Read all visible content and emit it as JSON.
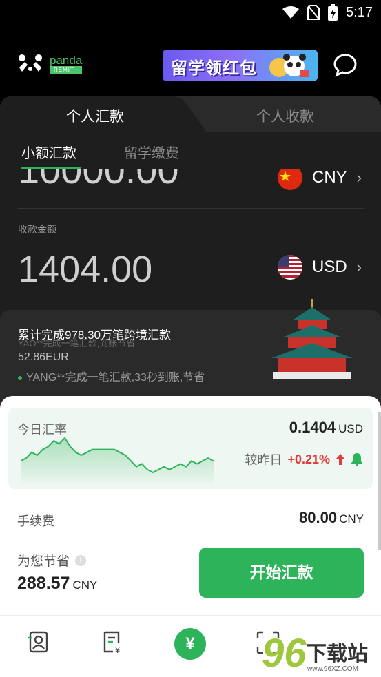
{
  "status_bar": {
    "time": "5:17",
    "icons": [
      "wifi-icon",
      "no-sim-icon",
      "battery-charging-icon"
    ]
  },
  "header": {
    "logo_name": "panda",
    "logo_sub": "REMIT",
    "banner_text": "留学领红包",
    "chat_icon": "chat-bubble-icon"
  },
  "tabs": [
    {
      "label": "个人汇款",
      "active": true
    },
    {
      "label": "个人收款",
      "active": false
    }
  ],
  "subtabs": [
    {
      "label": "小额汇款",
      "active": true
    },
    {
      "label": "留学缴费",
      "active": false
    }
  ],
  "send": {
    "amount": "10000.00",
    "currency": "CNY",
    "flag": "china-flag-icon"
  },
  "receive": {
    "label": "收款金额",
    "amount": "1404.00",
    "currency": "USD",
    "flag": "usa-flag-icon"
  },
  "ticker": {
    "title": "累计完成978.30万笔跨境汇款",
    "line0": "YAO**完成一笔汇款,到账节省",
    "line1": "52.86EUR",
    "line2": "YANG**完成一笔汇款,33秒到账,节省"
  },
  "rate": {
    "label": "今日汇率",
    "value": "0.1404",
    "unit": "USD",
    "change_label": "较昨日",
    "change_value": "+0.21%",
    "series": [
      0.1398,
      0.1399,
      0.1401,
      0.14,
      0.1402,
      0.1403,
      0.1405,
      0.1404,
      0.1406,
      0.1403,
      0.1401,
      0.14,
      0.1401,
      0.1402,
      0.1402,
      0.1402,
      0.1402,
      0.1402,
      0.1401,
      0.14,
      0.1398,
      0.1396,
      0.1397,
      0.1395,
      0.1394,
      0.1395,
      0.1396,
      0.1395,
      0.1396,
      0.1397,
      0.1396,
      0.1398,
      0.1397,
      0.1398,
      0.1399,
      0.1398
    ]
  },
  "fee": {
    "label": "手续费",
    "value": "80.00",
    "unit": "CNY"
  },
  "savings": {
    "label": "为您节省",
    "value": "288.57",
    "unit": "CNY"
  },
  "start_button": "开始汇款",
  "bottom_nav": [
    {
      "icon": "contacts-icon"
    },
    {
      "icon": "bill-icon"
    },
    {
      "icon": "yuan-icon",
      "glyph": "¥"
    },
    {
      "icon": "scan-icon"
    }
  ],
  "watermark": {
    "number": "96",
    "text": "下载站",
    "url": "www.96XZ.COM"
  },
  "colors": {
    "accent": "#2db35a",
    "up": "#e23b3b",
    "background": "#1e1e1e"
  }
}
